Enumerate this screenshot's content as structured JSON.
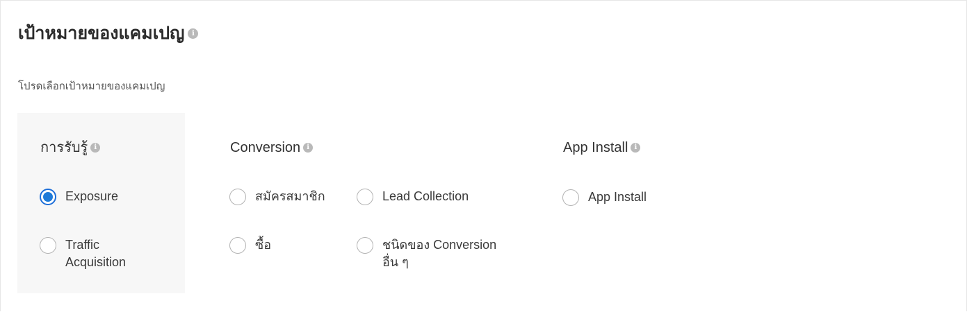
{
  "page": {
    "title": "เป้าหมายของแคมเปญ",
    "subtitle": "โปรดเลือกเป้าหมายของแคมเปญ",
    "info_icon": "info-icon"
  },
  "groups": [
    {
      "heading": "การรับรู้",
      "options": [
        {
          "label": "Exposure",
          "selected": true
        },
        {
          "label": "Traffic Acquisition",
          "label_lines": [
            "Traffic",
            "Acquisition"
          ],
          "selected": false
        }
      ]
    },
    {
      "heading": "Conversion",
      "options": [
        {
          "label": "สมัครสมาชิก",
          "selected": false
        },
        {
          "label": "Lead Collection",
          "selected": false
        },
        {
          "label": "ซื้อ",
          "selected": false
        },
        {
          "label": "ชนิดของ Conversion อื่น ๆ",
          "label_lines": [
            "ชนิดของ Conversion",
            "อื่น ๆ"
          ],
          "selected": false
        }
      ]
    },
    {
      "heading": "App Install",
      "options": [
        {
          "label": "App Install",
          "selected": false
        }
      ]
    }
  ],
  "colors": {
    "accent": "#1e7ad8",
    "highlight_bg": "#f7f7f7",
    "info_icon": "#b9b9b9"
  }
}
